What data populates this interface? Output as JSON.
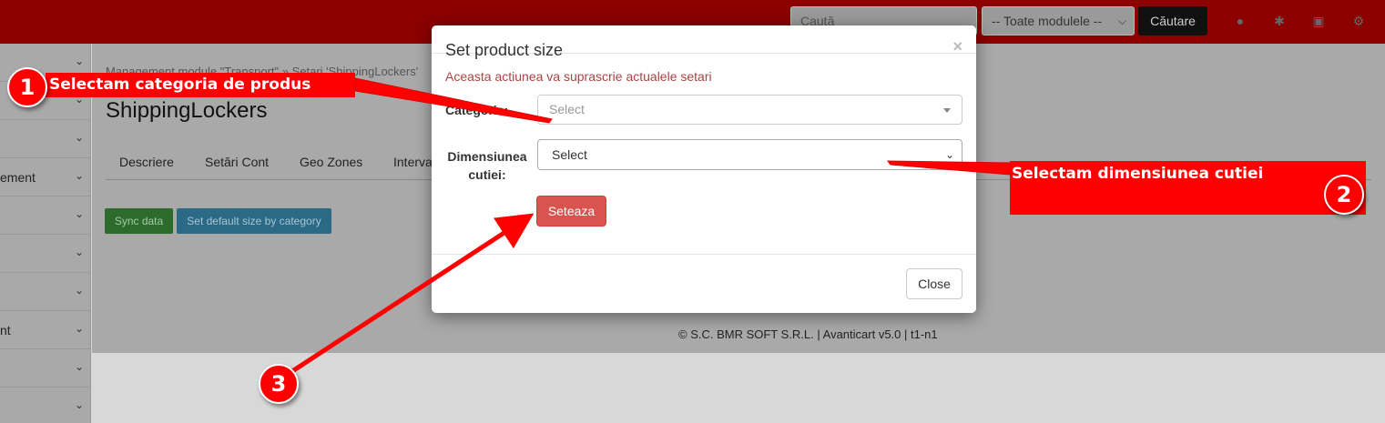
{
  "topbar": {
    "search_placeholder": "Caută",
    "module_select_value": "-- Toate modulele --",
    "search_button": "Căutare",
    "icons": [
      "bell-icon",
      "bug-icon",
      "briefcase-icon",
      "gear-icon"
    ]
  },
  "sidebar": {
    "items": [
      {
        "label": ""
      },
      {
        "label": ""
      },
      {
        "label": ""
      },
      {
        "label": "ement"
      },
      {
        "label": ""
      },
      {
        "label": ""
      },
      {
        "label": ""
      },
      {
        "label": "nt"
      },
      {
        "label": ""
      },
      {
        "label": ""
      }
    ]
  },
  "main": {
    "breadcrumb": "Management module \"Transport\" » Setari 'ShippingLockers'",
    "title": "ShippingLockers",
    "tabs": [
      {
        "label": "Descriere"
      },
      {
        "label": "Setări Cont"
      },
      {
        "label": "Geo Zones"
      },
      {
        "label": "Interva"
      }
    ],
    "sync_button": "Sync data",
    "default_size_button": "Set default size by category"
  },
  "footer": {
    "text": "© S.C. BMR SOFT S.R.L. | Avanticart v5.0 | t1-n1"
  },
  "modal": {
    "title": "Set product size",
    "close_x": "×",
    "warning": "Aceasta actiunea va suprascrie actualele setari",
    "category_label": "Categorie:",
    "category_value": "Select",
    "dimension_label": "Dimensiunea cutiei:",
    "dimension_value": "Select",
    "submit_button": "Seteaza",
    "close_button": "Close"
  },
  "annotations": {
    "accent_color": "#ff0000",
    "step1": {
      "number": "1",
      "text": "Selectam categoria de produs"
    },
    "step2": {
      "number": "2",
      "text": "Selectam dimensiunea cutiei"
    },
    "step3": {
      "number": "3"
    }
  }
}
